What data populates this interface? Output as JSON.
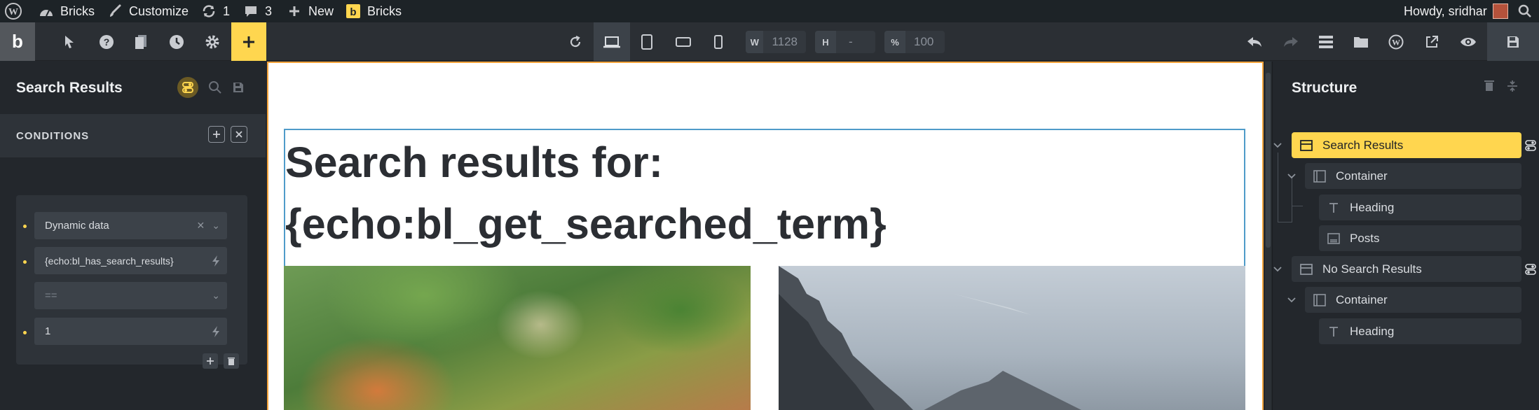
{
  "wp_bar": {
    "site_name": "Bricks",
    "customize": "Customize",
    "updates_count": "1",
    "comments_count": "3",
    "new_label": "New",
    "bricks_label": "Bricks",
    "howdy": "Howdy, sridhar"
  },
  "toolbar": {
    "logo": "b",
    "width_label": "W",
    "width_value": "1128",
    "height_label": "H",
    "height_value": "-",
    "scale_label": "%",
    "scale_value": "100",
    "accent_color": "#ffd64f"
  },
  "left_panel": {
    "title": "Search Results",
    "conditions_label": "CONDITIONS",
    "conditions": {
      "source": "Dynamic data",
      "tag": "{echo:bl_has_search_results}",
      "operator": "==",
      "value": "1"
    }
  },
  "canvas": {
    "heading_line1": "Search results for:",
    "heading_line2": "{echo:bl_get_searched_term}",
    "outline_color": "#f5a43b",
    "selection_color": "#4f9bc9"
  },
  "structure": {
    "title": "Structure",
    "items": [
      {
        "label": "Search Results",
        "icon": "section-icon"
      },
      {
        "label": "Container",
        "icon": "container-icon"
      },
      {
        "label": "Heading",
        "icon": "heading-icon"
      },
      {
        "label": "Posts",
        "icon": "posts-icon"
      },
      {
        "label": "No Search Results",
        "icon": "section-icon"
      },
      {
        "label": "Container",
        "icon": "container-icon"
      },
      {
        "label": "Heading",
        "icon": "heading-icon"
      }
    ]
  }
}
